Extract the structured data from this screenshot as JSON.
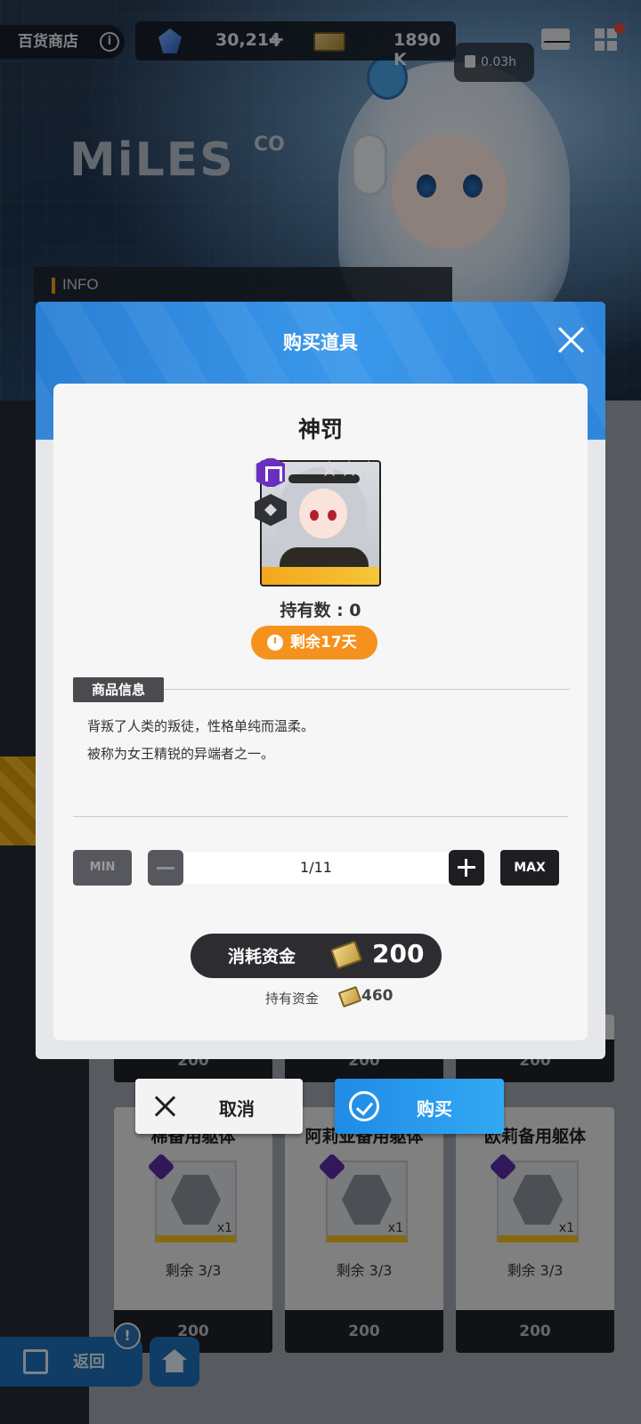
{
  "top_bar": {
    "shop_title": "百货商店",
    "info_icon": "info-icon",
    "gems": "30,214",
    "gems_plus": "+",
    "cash": "1890 K",
    "timer": "0.03h"
  },
  "banner": {
    "logo": "MiLES",
    "logo_suffix": "CO",
    "info_label": "INFO"
  },
  "shop_cards": [
    {
      "title": "棉备用躯体",
      "remain": "剩余 3/3",
      "qty": "x1",
      "price": "200"
    },
    {
      "title": "阿莉亚备用躯体",
      "remain": "剩余 3/3",
      "qty": "x1",
      "price": "200"
    },
    {
      "title": "欧莉备用躯体",
      "remain": "剩余 3/3",
      "qty": "x1",
      "price": "200"
    }
  ],
  "shop_prices_top": [
    "200",
    "200",
    "200"
  ],
  "modal": {
    "title": "购买道具",
    "item_name": "神罚",
    "owned": "持有数 : 0",
    "time_left": "剩余17天",
    "info_tag": "商品信息",
    "description": [
      "背叛了人类的叛徒，性格单纯而温柔。",
      "被称为女王精锐的异端者之一。"
    ],
    "min_label": "MIN",
    "max_label": "MAX",
    "quantity": "1/11",
    "cost_label": "消耗资金",
    "cost_value": "200",
    "owned_funds_label": "持有资金",
    "owned_funds_value": "460"
  },
  "actions": {
    "cancel": "取消",
    "buy": "购买"
  },
  "bottom_nav": {
    "back": "返回",
    "alert": "!"
  },
  "colors": {
    "accent_blue": "#2a7fd3",
    "orange": "#f5921d",
    "dark": "#2d2d31"
  }
}
